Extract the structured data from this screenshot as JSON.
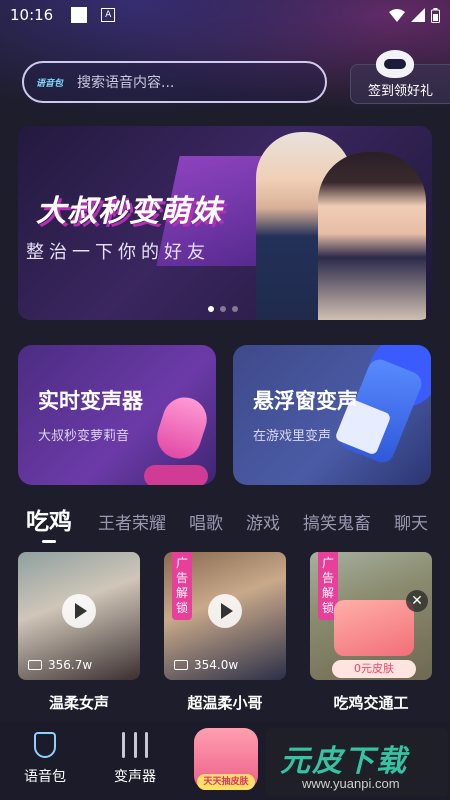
{
  "status_bar": {
    "time": "10:16",
    "a_icon": "A"
  },
  "search": {
    "tag": "语音包",
    "placeholder": "搜索语音内容..."
  },
  "checkin": {
    "label": "签到领好礼"
  },
  "banner": {
    "title": "大叔秒变萌妹",
    "subtitle": "整治一下你的好友"
  },
  "features": [
    {
      "title": "实时变声器",
      "subtitle": "大叔秒变萝莉音"
    },
    {
      "title": "悬浮窗变声",
      "subtitle": "在游戏里变声"
    }
  ],
  "categories": [
    "吃鸡",
    "王者荣耀",
    "唱歌",
    "游戏",
    "搞笑鬼畜",
    "聊天"
  ],
  "videos": [
    {
      "title": "温柔女声",
      "count": "356.7w",
      "ad": false
    },
    {
      "title": "超温柔小哥",
      "count": "354.0w",
      "ad": true,
      "ad_label": "广告解锁"
    },
    {
      "title": "吃鸡交通工",
      "count": "",
      "ad": true,
      "ad_label": "广告解锁",
      "gift_label": "0元皮肤"
    }
  ],
  "bottom_nav": {
    "voice_pack": "语音包",
    "changer": "变声器",
    "center_label": "天天抽皮肤"
  },
  "watermark": {
    "big": "元皮下载",
    "small": "www.yuanpi.com"
  }
}
